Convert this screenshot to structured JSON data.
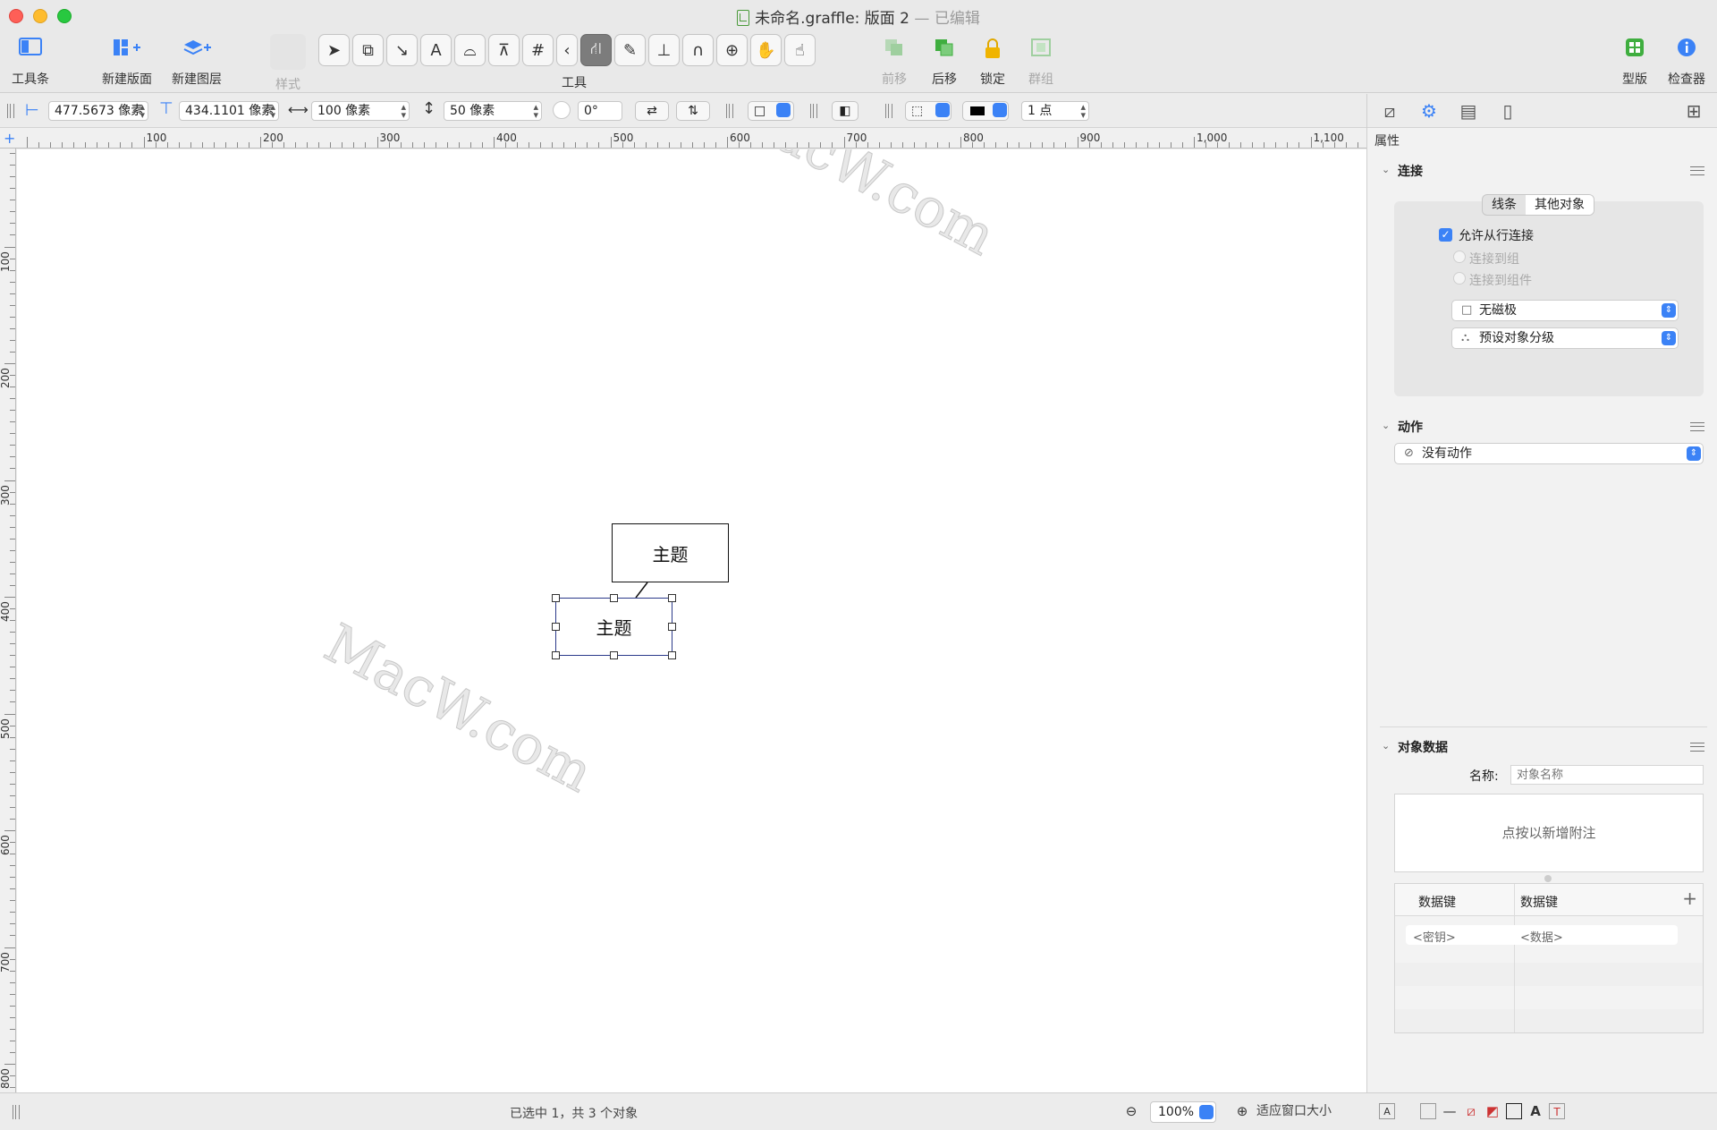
{
  "window": {
    "doc_name": "未命名.graffle: 版面 2",
    "separator": "—",
    "edited": "已编辑"
  },
  "toolbar": {
    "toolbar_toggle": "工具条",
    "new_canvas": "新建版面",
    "new_layer": "新建图层",
    "style": "样式",
    "tools": "工具",
    "bring_forward": "前移",
    "send_backward": "后移",
    "lock": "锁定",
    "group": "群组",
    "stencils": "型版",
    "inspector": "检查器"
  },
  "inspector_bar": {
    "x": "477.5673 像素",
    "y": "434.1101 像素",
    "width": "100 像素",
    "height": "50 像素",
    "rotation": "0°",
    "stroke_width": "1 点"
  },
  "ruler": {
    "h_labels": [
      "100",
      "200",
      "300",
      "400",
      "500",
      "600",
      "700",
      "800",
      "900",
      "1,000",
      "1,100"
    ],
    "v_labels": [
      "100",
      "200",
      "300",
      "400",
      "500",
      "600",
      "700",
      "800"
    ]
  },
  "canvas": {
    "shape1_text": "主题",
    "shape2_text": "主题",
    "watermark": "MacW.com"
  },
  "panel": {
    "heading": "属性",
    "connection": {
      "title": "连接",
      "seg_lines": "线条",
      "seg_other": "其他对象",
      "allow_from_lines": "允许从行连接",
      "connect_to_group": "连接到组",
      "connect_to_member": "连接到组件",
      "magnets": "无磁极",
      "hierarchy": "预设对象分级"
    },
    "action": {
      "title": "动作",
      "value": "没有动作"
    },
    "object_data": {
      "title": "对象数据",
      "name_label": "名称:",
      "name_placeholder": "对象名称",
      "note_hint": "点按以新增附注",
      "col_key": "数据键",
      "col_value": "数据键",
      "key_placeholder": "<密钥>",
      "value_placeholder": "<数据>"
    }
  },
  "statusbar": {
    "selection": "已选中 1，共 3 个对象",
    "zoom": "100%",
    "fit": "适应窗口大小"
  },
  "colors": {
    "accent": "#3b82f6",
    "close": "#fe5f57",
    "minimize": "#febc2e",
    "maximize": "#28c840",
    "green_icon": "#3fae3f"
  }
}
